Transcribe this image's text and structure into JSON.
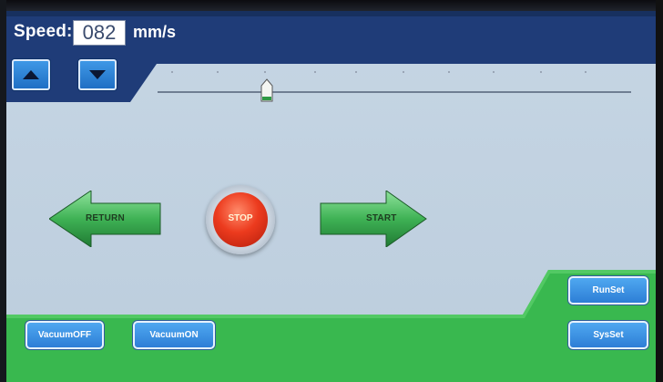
{
  "speed": {
    "label": "Speed:",
    "value": "082",
    "unit": "mm/s"
  },
  "speed_controls": {
    "up_icon": "up-triangle",
    "down_icon": "down-triangle"
  },
  "slider": {
    "position_fraction": 0.23
  },
  "motion": {
    "return_label": "RETURN",
    "stop_label": "STOP",
    "start_label": "START"
  },
  "buttons": {
    "vacuum_off": "VacuumOFF",
    "vacuum_on": "VacuumON",
    "runset": "RunSet",
    "sysset": "SysSet"
  },
  "colors": {
    "header": "#1d3a74",
    "background": "#c2d3e2",
    "green": "#34b34a",
    "stop": "#e23c1f",
    "button_blue": "#3d8fe0"
  }
}
